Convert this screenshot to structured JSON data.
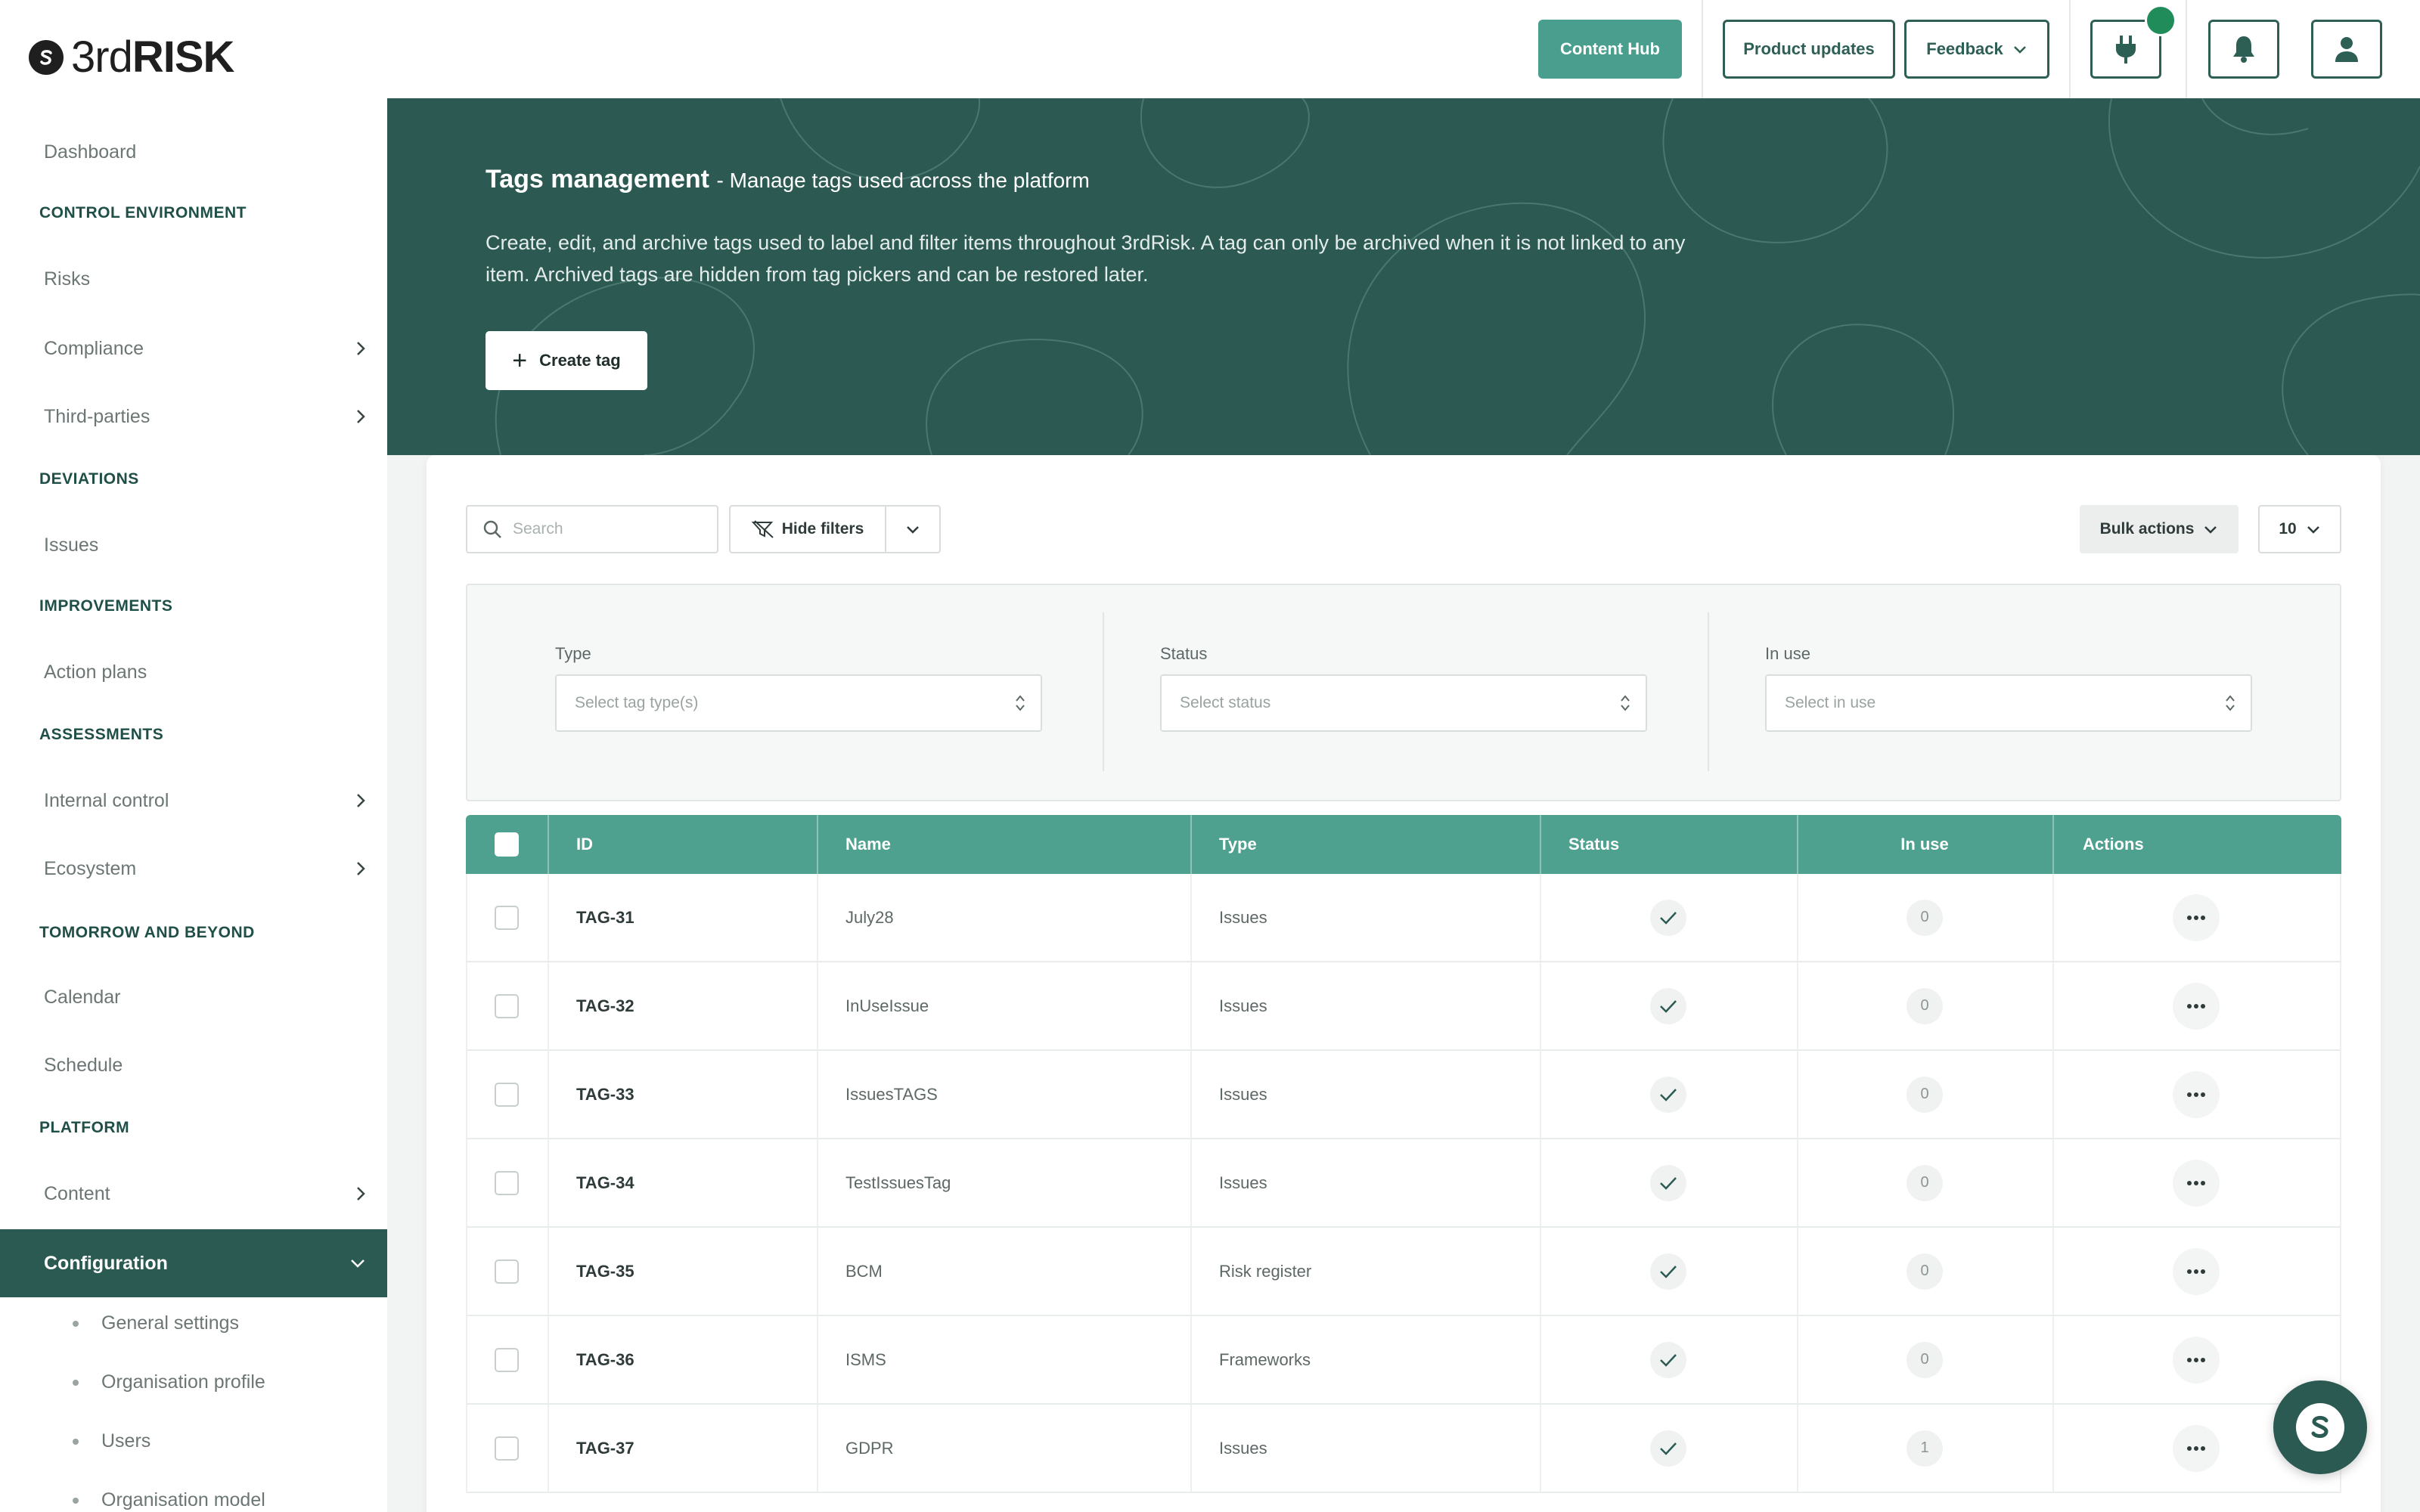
{
  "brand": {
    "logo_prefix": "3rd",
    "logo_suffix": "RISK",
    "icon": "brand-s-icon"
  },
  "header": {
    "content_hub": "Content Hub",
    "product_updates": "Product updates",
    "feedback": "Feedback",
    "icons": [
      "plug-icon",
      "bell-icon",
      "user-icon"
    ]
  },
  "sidebar": {
    "dashboard": "Dashboard",
    "sec_control": "CONTROL ENVIRONMENT",
    "risks": "Risks",
    "compliance": "Compliance",
    "third_parties": "Third-parties",
    "sec_deviations": "DEVIATIONS",
    "issues": "Issues",
    "sec_improvements": "IMPROVEMENTS",
    "action_plans": "Action plans",
    "sec_assessments": "ASSESSMENTS",
    "internal_control": "Internal control",
    "ecosystem": "Ecosystem",
    "sec_tomorrow": "TOMORROW AND BEYOND",
    "calendar": "Calendar",
    "schedule": "Schedule",
    "sec_platform": "PLATFORM",
    "content": "Content",
    "configuration": "Configuration",
    "sub": {
      "general_settings": "General settings",
      "organisation_profile": "Organisation profile",
      "users": "Users",
      "organisation_model": "Organisation model"
    }
  },
  "hero": {
    "title": "Tags management",
    "subtitle": "- Manage tags used across the platform",
    "description": "Create, edit, and archive tags used to label and filter items throughout 3rdRisk. A tag can only be archived when it is not linked to any item. Archived tags are hidden from tag pickers and can be restored later.",
    "create_button": "Create tag",
    "create_icon": "+"
  },
  "toolbar": {
    "search_placeholder": "Search",
    "hide_filters": "Hide filters",
    "bulk_actions": "Bulk actions",
    "page_size": "10"
  },
  "filters": {
    "type_label": "Type",
    "type_placeholder": "Select tag type(s)",
    "status_label": "Status",
    "status_placeholder": "Select status",
    "inuse_label": "In use",
    "inuse_placeholder": "Select in use"
  },
  "table": {
    "columns": {
      "id": "ID",
      "name": "Name",
      "type": "Type",
      "status": "Status",
      "in_use": "In use",
      "actions": "Actions"
    },
    "rows": [
      {
        "id": "TAG-31",
        "name": "July28",
        "type": "Issues",
        "status": "active",
        "in_use": "0"
      },
      {
        "id": "TAG-32",
        "name": "InUseIssue",
        "type": "Issues",
        "status": "active",
        "in_use": "0"
      },
      {
        "id": "TAG-33",
        "name": "IssuesTAGS",
        "type": "Issues",
        "status": "active",
        "in_use": "0"
      },
      {
        "id": "TAG-34",
        "name": "TestIssuesTag",
        "type": "Issues",
        "status": "active",
        "in_use": "0"
      },
      {
        "id": "TAG-35",
        "name": "BCM",
        "type": "Risk register",
        "status": "active",
        "in_use": "0"
      },
      {
        "id": "TAG-36",
        "name": "ISMS",
        "type": "Frameworks",
        "status": "active",
        "in_use": "0"
      },
      {
        "id": "TAG-37",
        "name": "GDPR",
        "type": "Issues",
        "status": "active",
        "in_use": "1"
      }
    ]
  },
  "colors": {
    "primary": "#2c5a53",
    "accent": "#4a9e8d",
    "table_header": "#4ea08f",
    "notification": "#1f8c5a"
  }
}
